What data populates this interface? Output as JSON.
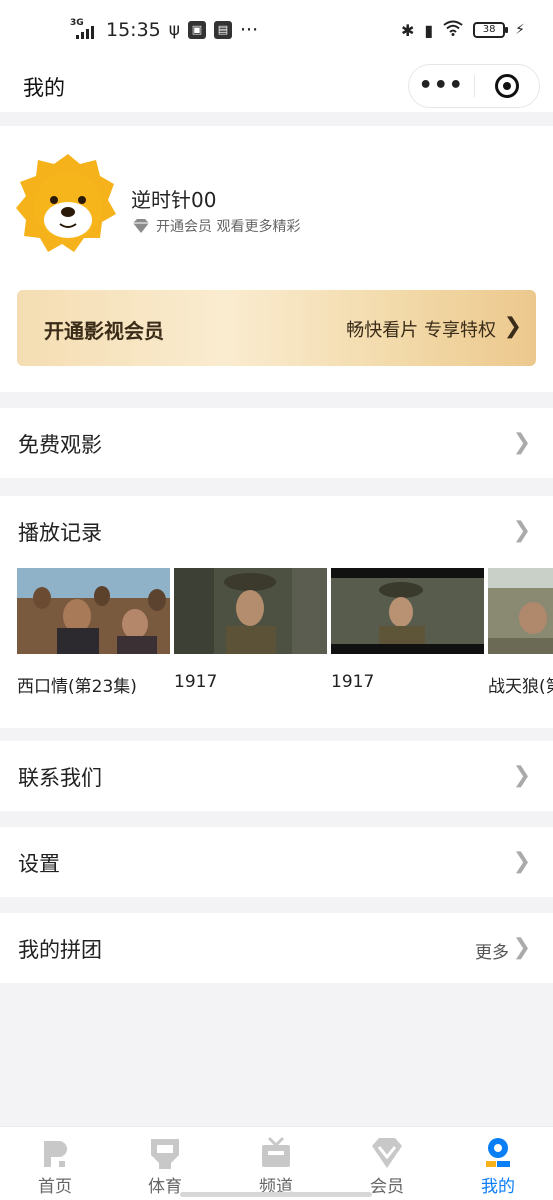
{
  "status_bar": {
    "net": "3G",
    "time": "15:35",
    "notif_icons": [
      "usb-icon",
      "app-icon-1",
      "app-icon-2"
    ],
    "more": "···",
    "battery": "38"
  },
  "header": {
    "title": "我的",
    "more_dots": "•••"
  },
  "profile": {
    "username": "逆时针00",
    "member_hint": "开通会员 观看更多精彩"
  },
  "vip_banner": {
    "title": "开通影视会员",
    "slogan": "畅快看片 专享特权"
  },
  "menu": {
    "free_movies": "免费观影",
    "history_title": "播放记录",
    "contact": "联系我们",
    "settings": "设置",
    "group_buy": "我的拼团",
    "group_more": "更多"
  },
  "history": [
    {
      "title": "西口情(第23集)"
    },
    {
      "title": "1917"
    },
    {
      "title": "1917"
    },
    {
      "title": "战天狼(第"
    }
  ],
  "tabs": [
    {
      "label": "首页",
      "icon": "home-icon"
    },
    {
      "label": "体育",
      "icon": "sports-icon"
    },
    {
      "label": "频道",
      "icon": "channel-tv-icon"
    },
    {
      "label": "会员",
      "icon": "vip-diamond-icon"
    },
    {
      "label": "我的",
      "icon": "profile-icon"
    }
  ],
  "colors": {
    "accent": "#0a7ef5",
    "vip_gold": "#f2d9a8",
    "mascot": "#f5b21a"
  }
}
